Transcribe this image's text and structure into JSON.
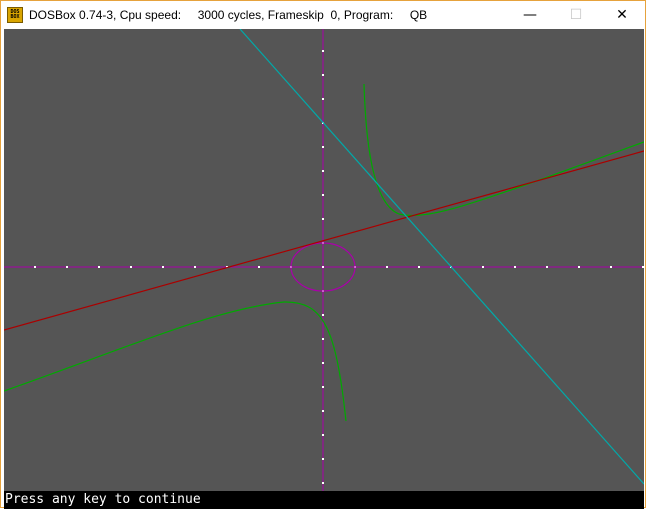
{
  "window": {
    "icon_text": [
      "DOS",
      "BOX"
    ],
    "title": "DOSBox 0.74-3, Cpu speed:     3000 cycles, Frameskip  0, Program:     QB",
    "controls": {
      "minimize": "—",
      "maximize": "☐",
      "close": "✕"
    }
  },
  "screen": {
    "background": "#555555",
    "status_text": "Press any key to continue"
  },
  "colors": {
    "axes": "#aa00aa",
    "ellipse": "#aa00aa",
    "hyperbola": "#00aa00",
    "red_line": "#aa0000",
    "cyan_line": "#00aaaa"
  },
  "plot": {
    "description_curves": [
      "axes",
      "ellipse",
      "hyperbola",
      "red-line",
      "cyan-line"
    ]
  }
}
